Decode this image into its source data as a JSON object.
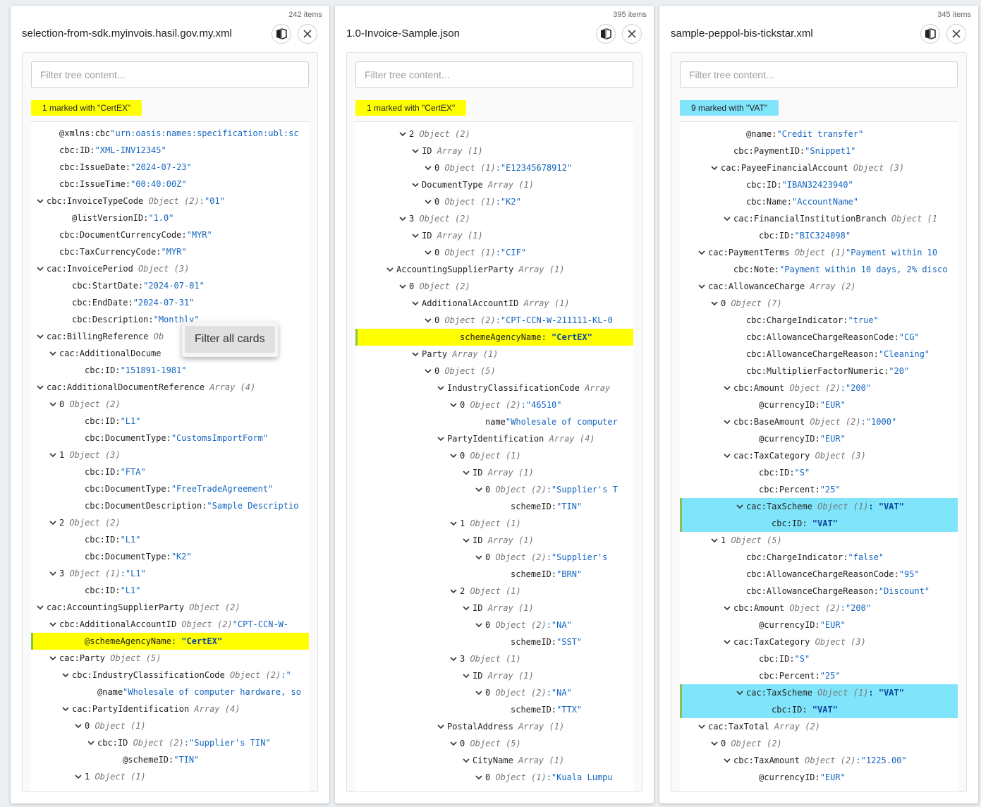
{
  "colors": {
    "marker_yellow": "#ffff00",
    "marker_cyan": "#80e5fa",
    "value_blue": "#1565c0"
  },
  "cards": [
    {
      "title": "selection-from-sdk.myinvois.hasil.gov.my.xml",
      "count": "242 items",
      "filter_placeholder": "Filter tree content...",
      "filter_value": "",
      "mark_label": "1 marked with \"CertEX\"",
      "mark_color": "#ffff00",
      "mark_type": "yellow",
      "scroll_offset": 0,
      "rows": [
        {
          "d": 2,
          "c": false,
          "k": "@xmlns:cbc",
          "t": "",
          "v": "\"urn:oasis:names:specification:ubl:sc"
        },
        {
          "d": 2,
          "c": false,
          "k": "cbc:ID:",
          "t": "",
          "v": "\"XML-INV12345\""
        },
        {
          "d": 2,
          "c": false,
          "k": "cbc:IssueDate:",
          "t": "",
          "v": "\"2024-07-23\""
        },
        {
          "d": 2,
          "c": false,
          "k": "cbc:IssueTime:",
          "t": "",
          "v": "\"00:40:00Z\""
        },
        {
          "d": 1,
          "c": true,
          "k": "cbc:InvoiceTypeCode ",
          "t": "Object (2)",
          "v": ":\"01\""
        },
        {
          "d": 3,
          "c": false,
          "k": "@listVersionID:",
          "t": "",
          "v": "\"1.0\""
        },
        {
          "d": 2,
          "c": false,
          "k": "cbc:DocumentCurrencyCode:",
          "t": "",
          "v": "\"MYR\""
        },
        {
          "d": 2,
          "c": false,
          "k": "cbc:TaxCurrencyCode:",
          "t": "",
          "v": "\"MYR\""
        },
        {
          "d": 1,
          "c": true,
          "k": "cac:InvoicePeriod ",
          "t": "Object (3)",
          "v": ""
        },
        {
          "d": 3,
          "c": false,
          "k": "cbc:StartDate:",
          "t": "",
          "v": "\"2024-07-01\""
        },
        {
          "d": 3,
          "c": false,
          "k": "cbc:EndDate:",
          "t": "",
          "v": "\"2024-07-31\""
        },
        {
          "d": 3,
          "c": false,
          "k": "cbc:Description:",
          "t": "",
          "v": "\"Monthly\""
        },
        {
          "d": 1,
          "c": true,
          "k": "cac:BillingReference ",
          "t": "Ob",
          "v": ""
        },
        {
          "d": 2,
          "c": true,
          "k": "cac:AdditionalDocume",
          "t": "",
          "v": ""
        },
        {
          "d": 4,
          "c": false,
          "k": "cbc:ID:",
          "t": "",
          "v": "\"151891-1981\""
        },
        {
          "d": 1,
          "c": true,
          "k": "cac:AdditionalDocumentReference ",
          "t": "Array (4)",
          "v": ""
        },
        {
          "d": 2,
          "c": true,
          "k": "0 ",
          "t": "Object (2)",
          "v": ""
        },
        {
          "d": 4,
          "c": false,
          "k": "cbc:ID:",
          "t": "",
          "v": "\"L1\""
        },
        {
          "d": 4,
          "c": false,
          "k": "cbc:DocumentType:",
          "t": "",
          "v": "\"CustomsImportForm\""
        },
        {
          "d": 2,
          "c": true,
          "k": "1 ",
          "t": "Object (3)",
          "v": ""
        },
        {
          "d": 4,
          "c": false,
          "k": "cbc:ID:",
          "t": "",
          "v": "\"FTA\""
        },
        {
          "d": 4,
          "c": false,
          "k": "cbc:DocumentType:",
          "t": "",
          "v": "\"FreeTradeAgreement\""
        },
        {
          "d": 4,
          "c": false,
          "k": "cbc:DocumentDescription:",
          "t": "",
          "v": "\"Sample Descriptio"
        },
        {
          "d": 2,
          "c": true,
          "k": "2 ",
          "t": "Object (2)",
          "v": ""
        },
        {
          "d": 4,
          "c": false,
          "k": "cbc:ID:",
          "t": "",
          "v": "\"L1\""
        },
        {
          "d": 4,
          "c": false,
          "k": "cbc:DocumentType:",
          "t": "",
          "v": "\"K2\""
        },
        {
          "d": 2,
          "c": true,
          "k": "3 ",
          "t": "Object (1)",
          "v": ":\"L1\""
        },
        {
          "d": 4,
          "c": false,
          "k": "cbc:ID:",
          "t": "",
          "v": "\"L1\""
        },
        {
          "d": 1,
          "c": true,
          "k": "cac:AccountingSupplierParty ",
          "t": "Object (2)",
          "v": ""
        },
        {
          "d": 2,
          "c": true,
          "k": "cbc:AdditionalAccountID ",
          "t": "Object (2)",
          "v": "\"CPT-CCN-W-"
        },
        {
          "d": 4,
          "c": false,
          "k": "@schemeAgencyName: ",
          "t": "",
          "v": "\"CertEX\"",
          "hl": true
        },
        {
          "d": 2,
          "c": true,
          "k": "cac:Party ",
          "t": "Object (5)",
          "v": ""
        },
        {
          "d": 3,
          "c": true,
          "k": "cbc:IndustryClassificationCode ",
          "t": "Object (2)",
          "v": ":\""
        },
        {
          "d": 5,
          "c": false,
          "k": "@name",
          "t": "",
          "v": "\"Wholesale of computer hardware, so"
        },
        {
          "d": 3,
          "c": true,
          "k": "cac:PartyIdentification ",
          "t": "Array (4)",
          "v": ""
        },
        {
          "d": 4,
          "c": true,
          "k": "0 ",
          "t": "Object (1)",
          "v": ""
        },
        {
          "d": 5,
          "c": true,
          "k": "cbc:ID ",
          "t": "Object (2)",
          "v": ":\"Supplier's TIN\""
        },
        {
          "d": 7,
          "c": false,
          "k": "@schemeID:",
          "t": "",
          "v": "\"TIN\""
        },
        {
          "d": 4,
          "c": true,
          "k": "1 ",
          "t": "Object (1)",
          "v": ""
        }
      ]
    },
    {
      "title": "1.0-Invoice-Sample.json",
      "count": "395 items",
      "filter_placeholder": "Filter tree content...",
      "filter_value": "",
      "mark_label": "1 marked with \"CertEX\"",
      "mark_color": "#ffff00",
      "mark_type": "yellow",
      "scroll_offset": 1,
      "rows": [
        {
          "d": 4,
          "c": true,
          "k": "2 ",
          "t": "Object (2)",
          "v": ""
        },
        {
          "d": 5,
          "c": true,
          "k": "ID ",
          "t": "Array (1)",
          "v": ""
        },
        {
          "d": 6,
          "c": true,
          "k": "0 ",
          "t": "Object (1)",
          "v": ":\"E12345678912\""
        },
        {
          "d": 5,
          "c": true,
          "k": "DocumentType ",
          "t": "Array (1)",
          "v": ""
        },
        {
          "d": 6,
          "c": true,
          "k": "0 ",
          "t": "Object (1)",
          "v": ":\"K2\""
        },
        {
          "d": 4,
          "c": true,
          "k": "3 ",
          "t": "Object (2)",
          "v": ""
        },
        {
          "d": 5,
          "c": true,
          "k": "ID ",
          "t": "Array (1)",
          "v": ""
        },
        {
          "d": 6,
          "c": true,
          "k": "0 ",
          "t": "Object (1)",
          "v": ":\"CIF\""
        },
        {
          "d": 3,
          "c": true,
          "k": "AccountingSupplierParty ",
          "t": "Array (1)",
          "v": ""
        },
        {
          "d": 4,
          "c": true,
          "k": "0 ",
          "t": "Object (2)",
          "v": ""
        },
        {
          "d": 5,
          "c": true,
          "k": "AdditionalAccountID ",
          "t": "Array (1)",
          "v": ""
        },
        {
          "d": 6,
          "c": true,
          "k": "0 ",
          "t": "Object (2)",
          "v": ":\"CPT-CCN-W-211111-KL-0"
        },
        {
          "d": 8,
          "c": false,
          "k": "schemeAgencyName: ",
          "t": "",
          "v": "\"CertEX\"",
          "hl": true
        },
        {
          "d": 5,
          "c": true,
          "k": "Party ",
          "t": "Array (1)",
          "v": ""
        },
        {
          "d": 6,
          "c": true,
          "k": "0 ",
          "t": "Object (5)",
          "v": ""
        },
        {
          "d": 7,
          "c": true,
          "k": "IndustryClassificationCode ",
          "t": "Array",
          "v": ""
        },
        {
          "d": 8,
          "c": true,
          "k": "0 ",
          "t": "Object (2)",
          "v": ":\"46510\""
        },
        {
          "d": 10,
          "c": false,
          "k": "name",
          "t": "",
          "v": "\"Wholesale of computer"
        },
        {
          "d": 7,
          "c": true,
          "k": "PartyIdentification ",
          "t": "Array (4)",
          "v": ""
        },
        {
          "d": 8,
          "c": true,
          "k": "0 ",
          "t": "Object (1)",
          "v": ""
        },
        {
          "d": 9,
          "c": true,
          "k": "ID ",
          "t": "Array (1)",
          "v": ""
        },
        {
          "d": 10,
          "c": true,
          "k": "0 ",
          "t": "Object (2)",
          "v": ":\"Supplier's T"
        },
        {
          "d": 12,
          "c": false,
          "k": "schemeID:",
          "t": "",
          "v": "\"TIN\""
        },
        {
          "d": 8,
          "c": true,
          "k": "1 ",
          "t": "Object (1)",
          "v": ""
        },
        {
          "d": 9,
          "c": true,
          "k": "ID ",
          "t": "Array (1)",
          "v": ""
        },
        {
          "d": 10,
          "c": true,
          "k": "0 ",
          "t": "Object (2)",
          "v": ":\"Supplier's"
        },
        {
          "d": 12,
          "c": false,
          "k": "schemeID:",
          "t": "",
          "v": "\"BRN\""
        },
        {
          "d": 8,
          "c": true,
          "k": "2 ",
          "t": "Object (1)",
          "v": ""
        },
        {
          "d": 9,
          "c": true,
          "k": "ID ",
          "t": "Array (1)",
          "v": ""
        },
        {
          "d": 10,
          "c": true,
          "k": "0 ",
          "t": "Object (2)",
          "v": ":\"NA\""
        },
        {
          "d": 12,
          "c": false,
          "k": "schemeID:",
          "t": "",
          "v": "\"SST\""
        },
        {
          "d": 8,
          "c": true,
          "k": "3 ",
          "t": "Object (1)",
          "v": ""
        },
        {
          "d": 9,
          "c": true,
          "k": "ID ",
          "t": "Array (1)",
          "v": ""
        },
        {
          "d": 10,
          "c": true,
          "k": "0 ",
          "t": "Object (2)",
          "v": ":\"NA\""
        },
        {
          "d": 12,
          "c": false,
          "k": "schemeID:",
          "t": "",
          "v": "\"TTX\""
        },
        {
          "d": 7,
          "c": true,
          "k": "PostalAddress ",
          "t": "Array (1)",
          "v": ""
        },
        {
          "d": 8,
          "c": true,
          "k": "0 ",
          "t": "Object (5)",
          "v": ""
        },
        {
          "d": 9,
          "c": true,
          "k": "CityName ",
          "t": "Array (1)",
          "v": ""
        },
        {
          "d": 10,
          "c": true,
          "k": "0 ",
          "t": "Object (1)",
          "v": ":\"Kuala Lumpu"
        }
      ]
    },
    {
      "title": "sample-peppol-bis-tickstar.xml",
      "count": "345 items",
      "filter_placeholder": "Filter tree content...",
      "filter_value": "",
      "mark_label": "9 marked with \"VAT\"",
      "mark_color": "#80e5fa",
      "mark_type": "cyan",
      "scroll_offset": 0,
      "rows": [
        {
          "d": 5,
          "c": false,
          "k": "@name:",
          "t": "",
          "v": "\"Credit transfer\""
        },
        {
          "d": 4,
          "c": false,
          "k": "cbc:PaymentID:",
          "t": "",
          "v": "\"Snippet1\""
        },
        {
          "d": 3,
          "c": true,
          "k": "cac:PayeeFinancialAccount ",
          "t": "Object (3)",
          "v": ""
        },
        {
          "d": 5,
          "c": false,
          "k": "cbc:ID:",
          "t": "",
          "v": "\"IBAN32423940\""
        },
        {
          "d": 5,
          "c": false,
          "k": "cbc:Name:",
          "t": "",
          "v": "\"AccountName\""
        },
        {
          "d": 4,
          "c": true,
          "k": "cac:FinancialInstitutionBranch ",
          "t": "Object (1",
          "v": ""
        },
        {
          "d": 6,
          "c": false,
          "k": "cbc:ID:",
          "t": "",
          "v": "\"BIC324098\""
        },
        {
          "d": 2,
          "c": true,
          "k": "cac:PaymentTerms ",
          "t": "Object (1)",
          "v": "\"Payment within 10"
        },
        {
          "d": 4,
          "c": false,
          "k": "cbc:Note:",
          "t": "",
          "v": "\"Payment within 10 days, 2% disco"
        },
        {
          "d": 2,
          "c": true,
          "k": "cac:AllowanceCharge ",
          "t": "Array (2)",
          "v": ""
        },
        {
          "d": 3,
          "c": true,
          "k": "0 ",
          "t": "Object (7)",
          "v": ""
        },
        {
          "d": 5,
          "c": false,
          "k": "cbc:ChargeIndicator:",
          "t": "",
          "v": "\"true\""
        },
        {
          "d": 5,
          "c": false,
          "k": "cbc:AllowanceChargeReasonCode:",
          "t": "",
          "v": "\"CG\""
        },
        {
          "d": 5,
          "c": false,
          "k": "cbc:AllowanceChargeReason:",
          "t": "",
          "v": "\"Cleaning\""
        },
        {
          "d": 5,
          "c": false,
          "k": "cbc:MultiplierFactorNumeric:",
          "t": "",
          "v": "\"20\""
        },
        {
          "d": 4,
          "c": true,
          "k": "cbc:Amount ",
          "t": "Object (2)",
          "v": ":\"200\""
        },
        {
          "d": 6,
          "c": false,
          "k": "@currencyID:",
          "t": "",
          "v": "\"EUR\""
        },
        {
          "d": 4,
          "c": true,
          "k": "cbc:BaseAmount ",
          "t": "Object (2)",
          "v": ":\"1000\""
        },
        {
          "d": 6,
          "c": false,
          "k": "@currencyID:",
          "t": "",
          "v": "\"EUR\""
        },
        {
          "d": 4,
          "c": true,
          "k": "cac:TaxCategory ",
          "t": "Object (3)",
          "v": ""
        },
        {
          "d": 6,
          "c": false,
          "k": "cbc:ID:",
          "t": "",
          "v": "\"S\""
        },
        {
          "d": 6,
          "c": false,
          "k": "cbc:Percent:",
          "t": "",
          "v": "\"25\""
        },
        {
          "d": 5,
          "c": true,
          "k": "cac:TaxScheme ",
          "t": "Object (1)",
          "v": ": \"VAT\"",
          "hl": true
        },
        {
          "d": 7,
          "c": false,
          "k": "cbc:ID: ",
          "t": "",
          "v": "\"VAT\"",
          "hl": true
        },
        {
          "d": 3,
          "c": true,
          "k": "1 ",
          "t": "Object (5)",
          "v": ""
        },
        {
          "d": 5,
          "c": false,
          "k": "cbc:ChargeIndicator:",
          "t": "",
          "v": "\"false\""
        },
        {
          "d": 5,
          "c": false,
          "k": "cbc:AllowanceChargeReasonCode:",
          "t": "",
          "v": "\"95\""
        },
        {
          "d": 5,
          "c": false,
          "k": "cbc:AllowanceChargeReason:",
          "t": "",
          "v": "\"Discount\""
        },
        {
          "d": 4,
          "c": true,
          "k": "cbc:Amount ",
          "t": "Object (2)",
          "v": ":\"200\""
        },
        {
          "d": 6,
          "c": false,
          "k": "@currencyID:",
          "t": "",
          "v": "\"EUR\""
        },
        {
          "d": 4,
          "c": true,
          "k": "cac:TaxCategory ",
          "t": "Object (3)",
          "v": ""
        },
        {
          "d": 6,
          "c": false,
          "k": "cbc:ID:",
          "t": "",
          "v": "\"S\""
        },
        {
          "d": 6,
          "c": false,
          "k": "cbc:Percent:",
          "t": "",
          "v": "\"25\""
        },
        {
          "d": 5,
          "c": true,
          "k": "cac:TaxScheme ",
          "t": "Object (1)",
          "v": ": \"VAT\"",
          "hl": true
        },
        {
          "d": 7,
          "c": false,
          "k": "cbc:ID: ",
          "t": "",
          "v": "\"VAT\"",
          "hl": true
        },
        {
          "d": 2,
          "c": true,
          "k": "cac:TaxTotal ",
          "t": "Array (2)",
          "v": ""
        },
        {
          "d": 3,
          "c": true,
          "k": "0 ",
          "t": "Object (2)",
          "v": ""
        },
        {
          "d": 4,
          "c": true,
          "k": "cbc:TaxAmount ",
          "t": "Object (2)",
          "v": ":\"1225.00\""
        },
        {
          "d": 6,
          "c": false,
          "k": "@currencyID:",
          "t": "",
          "v": "\"EUR\""
        }
      ]
    }
  ],
  "context_menu": {
    "item_label": "Filter all cards"
  }
}
